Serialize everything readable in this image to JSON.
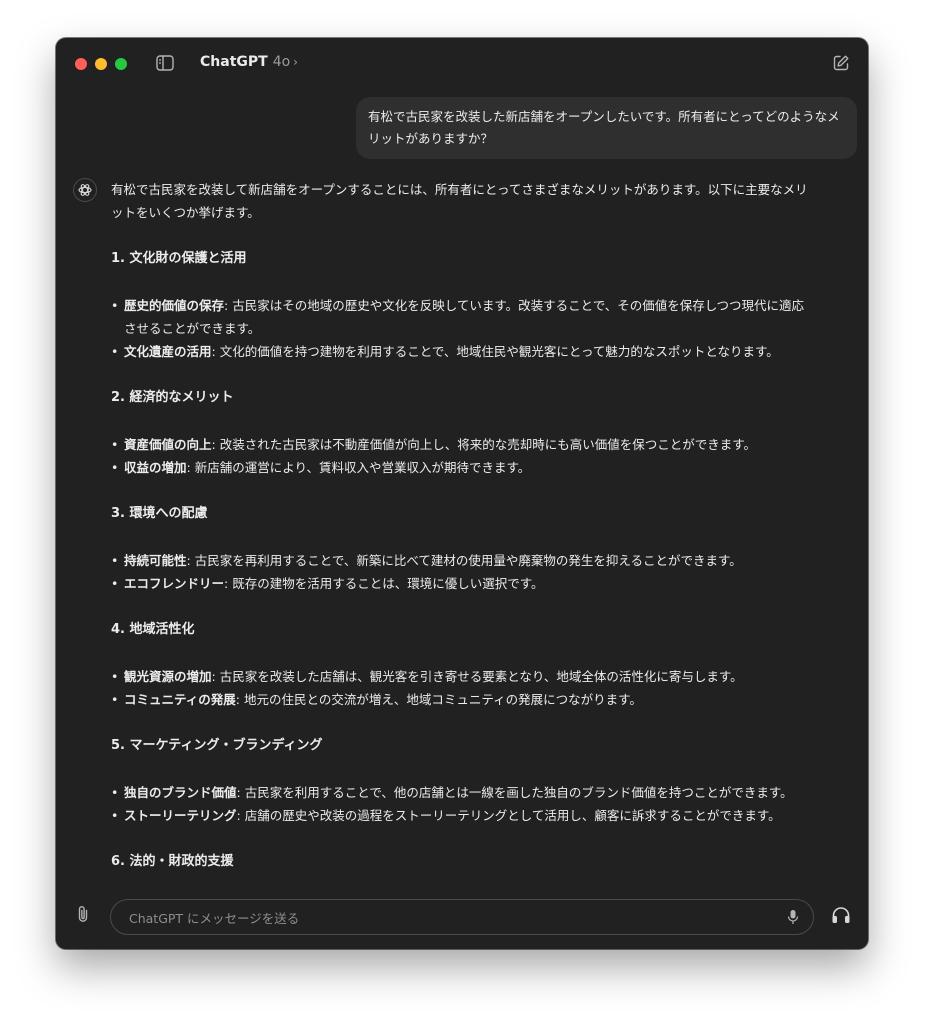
{
  "window": {
    "title": "ChatGPT",
    "model": "4o",
    "model_chevron": "›",
    "icons": [
      "sidebar-toggle-icon",
      "new-chat-icon"
    ]
  },
  "user_message": "有松で古民家を改装した新店舗をオープンしたいです。所有者にとってどのようなメリットがありますか？",
  "assistant": {
    "intro": "有松で古民家を改装して新店舗をオープンすることには、所有者にとってさまざまなメリットがあります。以下に主要なメリットをいくつか挙げます。",
    "sections": [
      {
        "heading": "1. 文化財の保護と活用",
        "items": [
          {
            "term": "歴史的価値の保存",
            "text": ": 古民家はその地域の歴史や文化を反映しています。改装することで、その価値を保存しつつ現代に適応させることができます。"
          },
          {
            "term": "文化遺産の活用",
            "text": ": 文化的価値を持つ建物を利用することで、地域住民や観光客にとって魅力的なスポットとなります。"
          }
        ]
      },
      {
        "heading": "2. 経済的なメリット",
        "items": [
          {
            "term": "資産価値の向上",
            "text": ": 改装された古民家は不動産価値が向上し、将来的な売却時にも高い価値を保つことができます。"
          },
          {
            "term": "収益の増加",
            "text": ": 新店舗の運営により、賃料収入や営業収入が期待できます。"
          }
        ]
      },
      {
        "heading": "3. 環境への配慮",
        "items": [
          {
            "term": "持続可能性",
            "text": ": 古民家を再利用することで、新築に比べて建材の使用量や廃棄物の発生を抑えることができます。"
          },
          {
            "term": "エコフレンドリー",
            "text": ": 既存の建物を活用することは、環境に優しい選択です。"
          }
        ]
      },
      {
        "heading": "4. 地域活性化",
        "items": [
          {
            "term": "観光資源の増加",
            "text": ": 古民家を改装した店舗は、観光客を引き寄せる要素となり、地域全体の活性化に寄与します。"
          },
          {
            "term": "コミュニティの発展",
            "text": ": 地元の住民との交流が増え、地域コミュニティの発展につながります。"
          }
        ]
      },
      {
        "heading": "5. マーケティング・ブランディング",
        "items": [
          {
            "term": "独自のブランド価値",
            "text": ": 古民家を利用することで、他の店舗とは一線を画した独自のブランド価値を持つことができます。"
          },
          {
            "term": "ストーリーテリング",
            "text": ": 店舗の歴史や改装の過程をストーリーテリングとして活用し、顧客に訴求することができます。"
          }
        ]
      },
      {
        "heading": "6. 法的・財政的支援",
        "items": []
      }
    ]
  },
  "scroll_down": "↓",
  "composer": {
    "placeholder": "ChatGPT にメッセージを送る",
    "value": "",
    "icons": [
      "attach-icon",
      "microphone-icon",
      "headphones-icon"
    ]
  },
  "colors": {
    "window_bg": "#212121",
    "bubble_bg": "#2f2f2f",
    "text": "#ececec",
    "muted": "#9b9b9b",
    "traffic_red": "#ff5f57",
    "traffic_yellow": "#febc2e",
    "traffic_green": "#28c840"
  }
}
